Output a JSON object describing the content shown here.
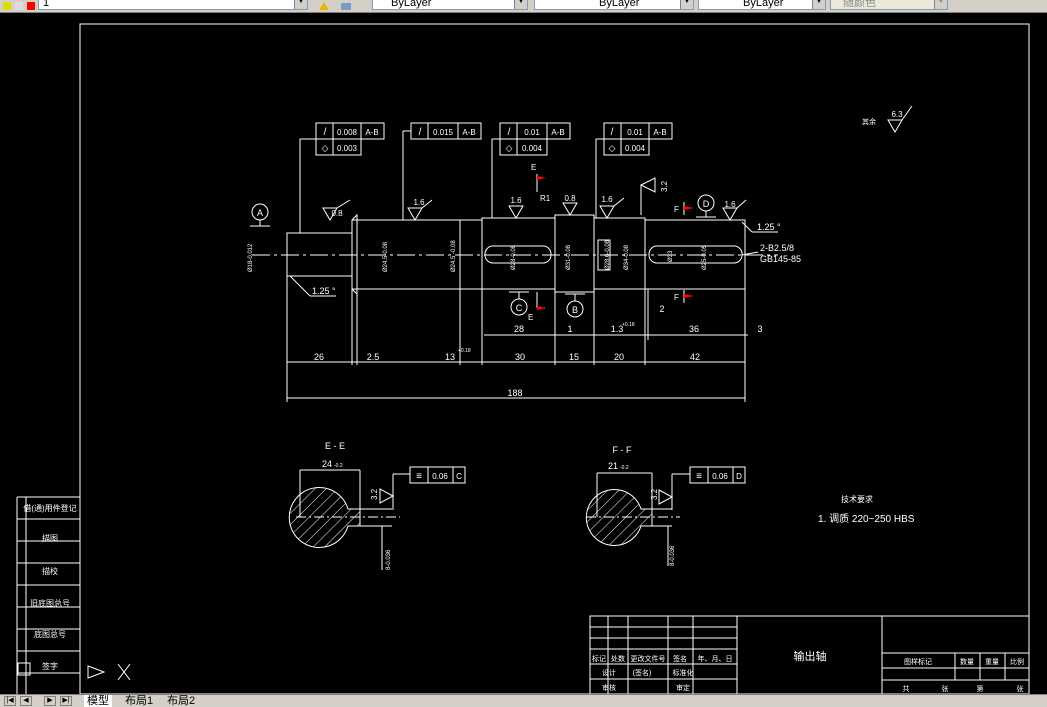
{
  "toolbar": {
    "layer_dropdown": "1",
    "color_dropdown": "ByLayer",
    "linetype_dropdown": "ByLayer",
    "lineweight_dropdown": "ByLayer",
    "plotstyle_dropdown": "随颜色"
  },
  "tabs": [
    "模型",
    "布局1",
    "布局2"
  ],
  "drawing": {
    "fcf1_row1": [
      "/",
      "0.008",
      "A-B"
    ],
    "fcf1_row2": [
      "◇",
      "0.003"
    ],
    "fcf2_row1": [
      "/",
      "0.015",
      "A-B"
    ],
    "fcf3_row1": [
      "/",
      "0.01",
      "A-B"
    ],
    "fcf3_row2": [
      "◇",
      "0.004"
    ],
    "fcf4_row1": [
      "/",
      "0.01",
      "A-B"
    ],
    "fcf4_row2": [
      "◇",
      "0.004"
    ],
    "datum_a": "A",
    "datum_b": "B",
    "datum_c": "C",
    "datum_d": "D",
    "rough_08a": "0.8",
    "rough_16a": "1.6",
    "rough_16b": "1.6",
    "rough_08b": "0.8",
    "rough_16c": "1.6",
    "rough_16d": "1.6",
    "rough_32": "3.2",
    "rough_other": "6.3",
    "rough_other_label": "其余",
    "section_e": "E",
    "section_f": "F",
    "r1": "R1",
    "chamfer_left": "1.25 °",
    "chamfer_right": "1.25 °",
    "center_hole": "2-B2.5/8",
    "center_std": "GB145-85",
    "dia_left": "Ø18-0.012",
    "dia_2": "Ø24.5-0.08",
    "dia_3": "Ø24.5 -0.08",
    "dia_4": "Ø28-0.08",
    "dia_5": "Ø31-0.08",
    "dia_6": "Ø28.6-0.08",
    "dia_7": "Ø34-0.08",
    "dia_8": "Ø33",
    "dia_9": "Ø25-0.05",
    "dim_26": "26",
    "dim_25": "2.5",
    "dim_13": "13",
    "dim_13_tol": "+0.18",
    "dim_30": "30",
    "dim_15": "15",
    "dim_20": "20",
    "dim_42": "42",
    "dim_188": "188",
    "dim_28": "28",
    "dim_1": "1",
    "dim_135": "1.3",
    "dim_135_tol": "+0.18",
    "dim_36": "36",
    "dim_3": "3",
    "dim_2": "2",
    "sec_ee_title": "E - E",
    "sec_ff_title": "F - F",
    "sec_ee_dim": "24",
    "sec_ff_dim": "21",
    "sec_tol": "-0.2",
    "sym_ee": [
      "≡",
      "0.06",
      "C"
    ],
    "sym_ff": [
      "≡",
      "0.06",
      "D"
    ],
    "sec_ee_key": "8-0.036",
    "sec_ff_key": "8-0.036",
    "req_title": "技术要求",
    "req_1": "1. 调质 220~250 HBS",
    "title_name": "输出轴",
    "tb_row_labels": [
      "标记",
      "处数",
      "更改文件号",
      "签名",
      "年、月、日"
    ],
    "tb_design": [
      "设计",
      "(签名)",
      "标准化"
    ],
    "tb_check": [
      "审核",
      "",
      "审定"
    ],
    "tb_right_labels": [
      "图样标记",
      "数量",
      "重量",
      "比例"
    ],
    "tb_right_bottom": [
      "共",
      "张",
      "第",
      "张"
    ],
    "left_col": [
      "借(通)用件登记",
      "描图",
      "描校",
      "旧底图总号",
      "底图总号",
      "签字"
    ]
  }
}
